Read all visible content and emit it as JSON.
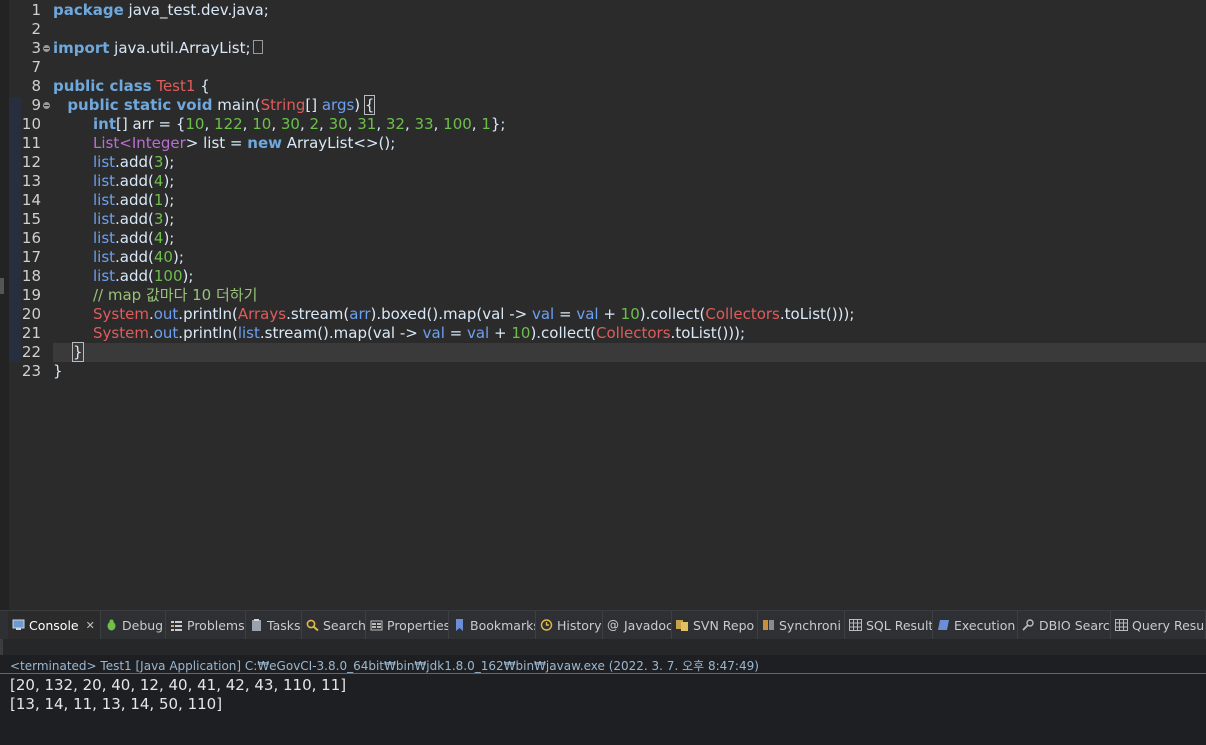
{
  "editor": {
    "line_numbers": [
      "1",
      "2",
      "3",
      "7",
      "8",
      "9",
      "10",
      "11",
      "12",
      "13",
      "14",
      "15",
      "16",
      "17",
      "18",
      "19",
      "20",
      "21",
      "22",
      "23"
    ]
  },
  "code": {
    "l1_kw": "package",
    "l1_rest": " java_test.dev.java;",
    "l3_kw": "import",
    "l3_rest": " java.util.ArrayList;",
    "l8_kw": "public class",
    "l8_cls": "Test1",
    "l8_rest": " {",
    "l9_indent": "   ",
    "l9_kw": "public static void",
    "l9_m": " main(",
    "l9_type": "String",
    "l9_mid": "[] ",
    "l9_param": "args",
    "l9_close": ") ",
    "l9_brace": "{",
    "l10_kw": "int",
    "l10_a": "[] arr = {",
    "l10_nums": [
      "10",
      "122",
      "10",
      "30",
      "2",
      "30",
      "31",
      "32",
      "33",
      "100",
      "1"
    ],
    "l10_end": "};",
    "l11_type": "List",
    "l11_lt": "<",
    "l11_generic": "Integer",
    "l11_a": "> list = ",
    "l11_kw": "new",
    "l11_b": " ArrayList<>();",
    "adds": [
      "3",
      "4",
      "1",
      "3",
      "4",
      "40",
      "100"
    ],
    "list_var": "list",
    "add_call": ".add(",
    "add_end": ");",
    "l19_comment": "// map 값마다 10 더하기",
    "sys": "System",
    "out": "out",
    "println": ".println(",
    "l20_arrays": "Arrays",
    "l20_a": ".stream(",
    "l20_arr": "arr",
    "l20_b": ").boxed().map(val -> ",
    "l20_val1": "val",
    "l20_eq": " = ",
    "l20_val2": "val",
    "l20_plus": " + ",
    "l20_ten": "10",
    "l20_c": ").collect(",
    "l20_collectors": "Collectors",
    "l20_d": ".toList()));",
    "l21_b": ".stream().map(val -> ",
    "l22_brace": "}",
    "l23_brace": "}"
  },
  "tabs": [
    {
      "label": "Console",
      "icon": "console-icon",
      "active": true,
      "close": "✕"
    },
    {
      "label": "Debug",
      "icon": "debug-bug-icon"
    },
    {
      "label": "Problems",
      "icon": "problems-icon"
    },
    {
      "label": "Tasks",
      "icon": "tasks-clipboard-icon"
    },
    {
      "label": "Search",
      "icon": "search-icon"
    },
    {
      "label": "Properties",
      "icon": "properties-icon"
    },
    {
      "label": "Bookmarks",
      "icon": "bookmark-icon"
    },
    {
      "label": "History",
      "icon": "history-icon"
    },
    {
      "label": "Javadoc",
      "icon": "javadoc-at-icon"
    },
    {
      "label": "SVN Repo",
      "icon": "svn-repository-icon"
    },
    {
      "label": "Synchroni",
      "icon": "synchronize-icon"
    },
    {
      "label": "SQL Result",
      "icon": "sql-result-grid-icon"
    },
    {
      "label": "Execution",
      "icon": "execution-plan-icon"
    },
    {
      "label": "DBIO Searc",
      "icon": "dbio-search-icon"
    },
    {
      "label": "Query Resu",
      "icon": "query-result-grid-icon"
    }
  ],
  "console": {
    "status": "<terminated> Test1 [Java Application] C:₩eGovCI-3.8.0_64bit₩bin₩jdk1.8.0_162₩bin₩javaw.exe (2022. 3. 7. 오후 8:47:49)",
    "output": [
      "[20, 132, 20, 40, 12, 40, 41, 42, 43, 110, 11]",
      "[13, 14, 11, 13, 14, 50, 110]"
    ]
  },
  "colors": {
    "keyword": "#cc7832",
    "class_ref": "#e05c5c",
    "number": "#6cc04a",
    "field": "#6ca0f0",
    "comment": "#98c379",
    "background": "#2b2b2b"
  }
}
